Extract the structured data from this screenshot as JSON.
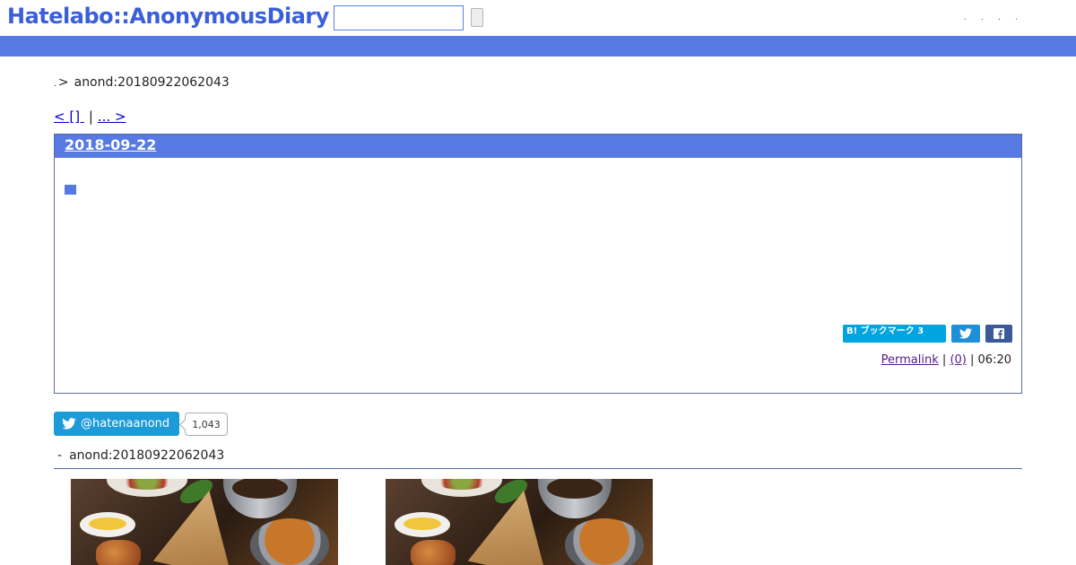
{
  "header": {
    "logo_text": "Hatelabo::AnonymousDiary",
    "search": {
      "value": "",
      "placeholder": ""
    },
    "brand_color": "#3b5fd9",
    "bar_color": "#5679e3",
    "links": [
      ".",
      ".",
      ".",
      "."
    ]
  },
  "breadcrumb": {
    "dot": ".",
    "separator": ">",
    "current": "anond:20180922062043"
  },
  "pager": {
    "prev_label": "< []  ",
    "divider": "|",
    "next_label": "... > "
  },
  "entry": {
    "date": "2018-09-22",
    "title_link": "■",
    "hatebu_label": "B! ブックマーク 3",
    "share_twitter_icon": "twitter-icon",
    "share_facebook_icon": "facebook-icon",
    "meta": {
      "permalink": "Permalink",
      "sep1": "|",
      "comments": "(0)",
      "sep2": "|",
      "time": "06:20"
    }
  },
  "follow": {
    "handle": "@hatenaanond",
    "count": "1,043"
  },
  "related": {
    "dash": "-",
    "title": "anond:20180922062043",
    "thumbnails": [
      "food-photo",
      "food-photo"
    ]
  }
}
